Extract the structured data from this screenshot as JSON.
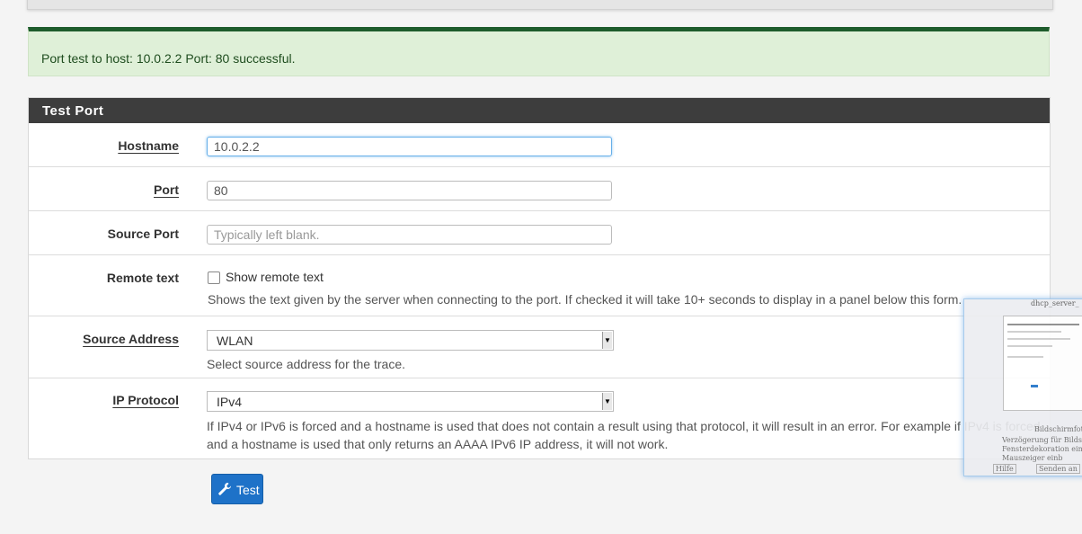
{
  "alert": {
    "message": "Port test to host: 10.0.2.2 Port: 80 successful."
  },
  "panel": {
    "title": "Test Port"
  },
  "form": {
    "hostname": {
      "label": "Hostname",
      "value": "10.0.2.2"
    },
    "port": {
      "label": "Port",
      "value": "80"
    },
    "source_port": {
      "label": "Source Port",
      "placeholder": "Typically left blank."
    },
    "remote_text": {
      "label": "Remote text",
      "checkbox_label": "Show remote text",
      "checked": false,
      "help": "Shows the text given by the server when connecting to the port. If checked it will take 10+ seconds to display in a panel below this form."
    },
    "source_address": {
      "label": "Source Address",
      "selected": "WLAN",
      "help": "Select source address for the trace."
    },
    "ip_protocol": {
      "label": "IP Protocol",
      "selected": "IPv4",
      "help_line1": "If IPv4 or IPv6 is forced and a hostname is used that does not contain a result using that protocol, it will result in an error. For example if IPv4 is forced",
      "help_line2": "and a hostname is used that only returns an AAAA IPv6 IP address, it will not work."
    }
  },
  "buttons": {
    "test_label": "Test",
    "test_icon": "wrench-icon"
  },
  "overlay_thumbnail": {
    "title": "dhcp_server_",
    "lines": [
      "Bildschirmfoto",
      "Verzögerung für Bildsch",
      "Fensterdekoration ein",
      "Mauszeiger einb"
    ],
    "help_button": "Hilfe",
    "send_button": "Senden an"
  }
}
